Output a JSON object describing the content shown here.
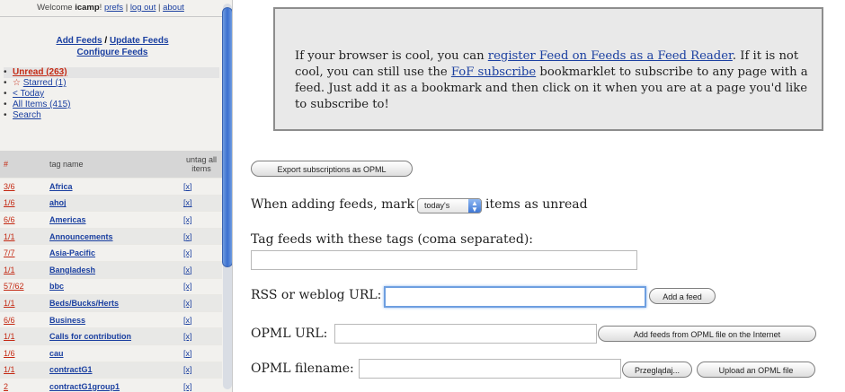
{
  "sidebar": {
    "welcome": {
      "prefix": "Welcome",
      "user": "icamp",
      "prefs": "prefs",
      "logout": "log out",
      "about": "about",
      "sep": "|"
    },
    "links": {
      "add_feeds": "Add Feeds",
      "slash": "/",
      "update_feeds": "Update Feeds",
      "configure_feeds": "Configure Feeds"
    },
    "views": [
      {
        "label": "Unread (263)",
        "icon": "",
        "state": "selected"
      },
      {
        "label": "Starred (1)",
        "icon": "star-icon",
        "state": ""
      },
      {
        "label": "< Today",
        "icon": "",
        "state": ""
      },
      {
        "label": "All Items (415)",
        "icon": "",
        "state": ""
      },
      {
        "label": "Search",
        "icon": "",
        "state": ""
      }
    ],
    "table": {
      "headers": {
        "num": "#",
        "name": "tag name",
        "untag": "untag all items"
      },
      "rows": [
        {
          "num": "3/6",
          "name": "Africa",
          "untag": "[x]"
        },
        {
          "num": "1/6",
          "name": "ahoj",
          "untag": "[x]"
        },
        {
          "num": "6/6",
          "name": "Americas",
          "untag": "[x]"
        },
        {
          "num": "1/1",
          "name": "Announcements",
          "untag": "[x]"
        },
        {
          "num": "7/7",
          "name": "Asia-Pacific",
          "untag": "[x]"
        },
        {
          "num": "1/1",
          "name": "Bangladesh",
          "untag": "[x]"
        },
        {
          "num": "57/62",
          "name": "bbc",
          "untag": "[x]"
        },
        {
          "num": "1/1",
          "name": "Beds/Bucks/Herts",
          "untag": "[x]"
        },
        {
          "num": "6/6",
          "name": "Business",
          "untag": "[x]"
        },
        {
          "num": "1/1",
          "name": "Calls for contribution",
          "untag": "[x]"
        },
        {
          "num": "1/6",
          "name": "cau",
          "untag": "[x]"
        },
        {
          "num": "1/1",
          "name": "contractG1",
          "untag": "[x]"
        },
        {
          "num": "2",
          "name": "contractG1group1",
          "untag": "[x]"
        }
      ]
    }
  },
  "main": {
    "info": {
      "t1": "If your browser is cool, you can ",
      "link1": "register Feed on Feeds as a Feed Reader",
      "t2": ". If it is not cool, you can still use the ",
      "link2": "FoF subscribe",
      "t3": " bookmarklet to subscribe to any page with a feed. Just add it as a bookmark and then click on it when you are at a page you'd like to subscribe to!"
    },
    "export_button": "Export subscriptions as OPML",
    "mark_unread": {
      "before": "When adding feeds, mark",
      "selected": "today's",
      "after": "items as unread"
    },
    "tags_label": "Tag feeds with these tags (coma separated):",
    "tags_value": "",
    "rss_label": "RSS or weblog URL:",
    "rss_value": "",
    "add_feed_button": "Add a feed",
    "opml_url_label": "OPML URL:",
    "opml_url_value": "",
    "opml_url_button": "Add feeds from OPML file on the Internet",
    "opml_file_label": "OPML filename:",
    "browse_button": "Przeglądaj...",
    "upload_button": "Upload an OPML file"
  }
}
